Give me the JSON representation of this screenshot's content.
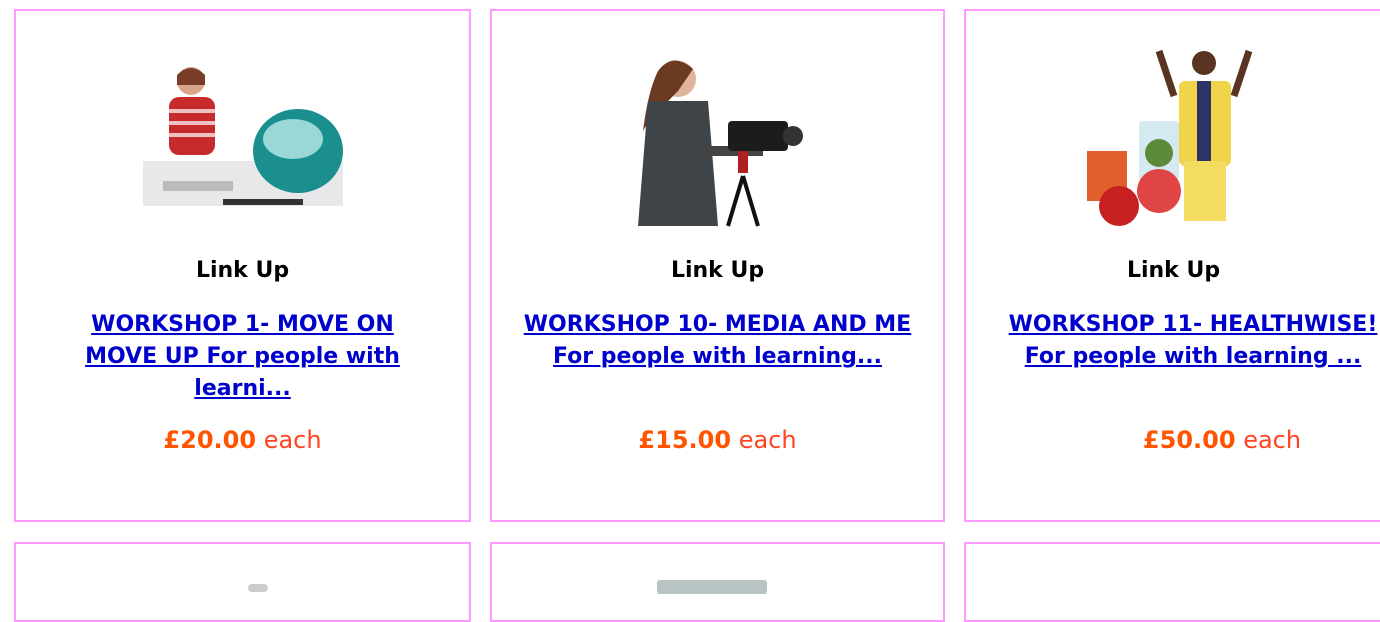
{
  "products": [
    {
      "image_icon": "person-with-computer-image",
      "brand": "Link Up",
      "title": "WORKSHOP 1- MOVE ON MOVE UP For people with learni...",
      "price": "£20.00",
      "unit": "each"
    },
    {
      "image_icon": "person-with-video-camera-image",
      "brand": "Link Up",
      "title": "WORKSHOP 10- MEDIA AND ME For people with learning...",
      "price": "£15.00",
      "unit": "each"
    },
    {
      "image_icon": "healthy-food-athlete-image",
      "brand": "Link Up",
      "title": "WORKSHOP 11- HEALTHWISE! For people with learning ...",
      "price": "£50.00",
      "unit": "each"
    }
  ],
  "colors": {
    "card_border": "#ff99ff",
    "link": "#0000cc",
    "price": "#ff5500"
  }
}
